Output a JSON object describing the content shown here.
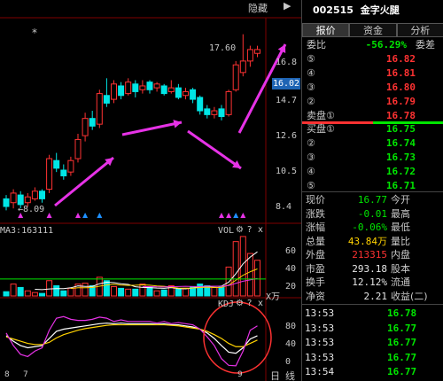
{
  "toolbar": {
    "hide_label": "隐藏",
    "arrow_icon": "chevron-right"
  },
  "chart": {
    "star_marker": "*",
    "high_label": "17.60",
    "low_label": "8.09",
    "current_price": "16.02",
    "price_axis": [
      "16.8",
      "14.7",
      "12.6",
      "10.5",
      "8.4"
    ],
    "vol_axis": [
      "60",
      "40",
      "20"
    ],
    "vol_unit": "X万",
    "kdj_axis": [
      "80",
      "40",
      "0"
    ],
    "ma_label": "MA3:163111",
    "vol_label": "VOL",
    "kdj_label": "KDJ",
    "gear_icon": "gear",
    "help_icon": "?",
    "close_icon": "x",
    "bottom_labels": [
      "8",
      "7",
      "9",
      "日",
      "线"
    ],
    "colors": {
      "up": "#ff3232",
      "down": "#00e6e6",
      "arrow": "#e632e6",
      "k": "#ffffff",
      "d": "#ffd200",
      "j": "#e632e6",
      "circle": "#ff3232"
    }
  },
  "chart_data": {
    "type": "candlestick",
    "candles": [
      {
        "o": 9.0,
        "c": 8.6,
        "h": 9.2,
        "l": 8.4
      },
      {
        "o": 8.8,
        "c": 9.3,
        "h": 9.5,
        "l": 8.5
      },
      {
        "o": 9.2,
        "c": 8.7,
        "h": 9.4,
        "l": 8.5
      },
      {
        "o": 8.8,
        "c": 9.1,
        "h": 9.3,
        "l": 8.6
      },
      {
        "o": 9.0,
        "c": 9.4,
        "h": 9.6,
        "l": 8.9
      },
      {
        "o": 9.4,
        "c": 9.0,
        "h": 9.5,
        "l": 8.8
      },
      {
        "o": 9.5,
        "c": 11.1,
        "h": 11.3,
        "l": 9.3
      },
      {
        "o": 11.0,
        "c": 10.6,
        "h": 11.4,
        "l": 10.4
      },
      {
        "o": 10.5,
        "c": 10.2,
        "h": 10.8,
        "l": 10.0
      },
      {
        "o": 10.4,
        "c": 11.0,
        "h": 11.2,
        "l": 10.2
      },
      {
        "o": 11.1,
        "c": 12.1,
        "h": 12.4,
        "l": 10.9
      },
      {
        "o": 12.3,
        "c": 13.2,
        "h": 13.5,
        "l": 12.0
      },
      {
        "o": 13.2,
        "c": 12.8,
        "h": 13.6,
        "l": 12.6
      },
      {
        "o": 12.9,
        "c": 14.5,
        "h": 14.7,
        "l": 12.7
      },
      {
        "o": 14.4,
        "c": 14.0,
        "h": 15.3,
        "l": 13.8
      },
      {
        "o": 14.2,
        "c": 15.0,
        "h": 15.2,
        "l": 14.0
      },
      {
        "o": 14.9,
        "c": 14.4,
        "h": 15.1,
        "l": 14.2
      },
      {
        "o": 14.5,
        "c": 15.1,
        "h": 15.3,
        "l": 14.4
      },
      {
        "o": 15.0,
        "c": 14.6,
        "h": 15.2,
        "l": 14.3
      },
      {
        "o": 14.7,
        "c": 14.9,
        "h": 15.2,
        "l": 14.5
      },
      {
        "o": 15.1,
        "c": 14.7,
        "h": 15.2,
        "l": 14.5
      },
      {
        "o": 14.8,
        "c": 15.0,
        "h": 15.1,
        "l": 14.6
      },
      {
        "o": 14.9,
        "c": 14.5,
        "h": 15.0,
        "l": 14.4
      },
      {
        "o": 14.6,
        "c": 14.8,
        "h": 15.2,
        "l": 14.5
      },
      {
        "o": 14.8,
        "c": 14.3,
        "h": 15.0,
        "l": 14.2
      },
      {
        "o": 14.4,
        "c": 14.6,
        "h": 14.8,
        "l": 14.2
      },
      {
        "o": 14.7,
        "c": 14.2,
        "h": 14.8,
        "l": 14.0
      },
      {
        "o": 14.3,
        "c": 13.6,
        "h": 14.4,
        "l": 13.4
      },
      {
        "o": 13.7,
        "c": 13.4,
        "h": 13.9,
        "l": 13.2
      },
      {
        "o": 13.4,
        "c": 13.6,
        "h": 13.8,
        "l": 13.2
      },
      {
        "o": 13.7,
        "c": 13.3,
        "h": 13.9,
        "l": 13.1
      },
      {
        "o": 13.4,
        "c": 14.6,
        "h": 14.7,
        "l": 13.3
      },
      {
        "o": 14.7,
        "c": 16.0,
        "h": 16.2,
        "l": 14.6
      },
      {
        "o": 15.6,
        "c": 16.2,
        "h": 17.6,
        "l": 15.4
      },
      {
        "o": 16.2,
        "c": 16.8,
        "h": 17.0,
        "l": 15.9
      },
      {
        "o": 16.6,
        "c": 16.8,
        "h": 17.0,
        "l": 16.4
      }
    ],
    "volumes": [
      5,
      14,
      10,
      6,
      4,
      3,
      18,
      12,
      6,
      9,
      14,
      15,
      12,
      22,
      18,
      11,
      9,
      8,
      8,
      14,
      10,
      6,
      7,
      12,
      8,
      9,
      11,
      14,
      12,
      10,
      11,
      34,
      64,
      70,
      50,
      42
    ],
    "kdj": {
      "k": [
        50,
        40,
        32,
        28,
        30,
        32,
        45,
        58,
        62,
        64,
        66,
        68,
        70,
        72,
        73,
        72,
        73,
        72,
        72,
        72,
        72,
        71,
        72,
        70,
        70,
        68,
        66,
        62,
        55,
        45,
        32,
        20,
        18,
        28,
        44,
        50
      ],
      "d": [
        48,
        44,
        40,
        36,
        34,
        34,
        38,
        46,
        52,
        56,
        60,
        63,
        65,
        67,
        69,
        70,
        70,
        70,
        70,
        70,
        70,
        70,
        70,
        69,
        68,
        66,
        64,
        62,
        58,
        52,
        45,
        36,
        30,
        30,
        36,
        42
      ],
      "j": [
        55,
        32,
        16,
        12,
        22,
        28,
        60,
        82,
        85,
        80,
        78,
        78,
        80,
        84,
        82,
        76,
        79,
        76,
        76,
        76,
        76,
        73,
        76,
        72,
        74,
        72,
        70,
        62,
        48,
        32,
        8,
        -4,
        -5,
        22,
        60,
        68
      ]
    }
  },
  "stock": {
    "code": "002515",
    "name": "金字火腿"
  },
  "tabs": [
    "报价",
    "资金",
    "分析"
  ],
  "weibi": {
    "label": "委比",
    "value": "-56.29%",
    "label2": "委差",
    "value2": ""
  },
  "sell_orders": [
    {
      "label": "⑤",
      "price": "16.82",
      "vol": ""
    },
    {
      "label": "④",
      "price": "16.81",
      "vol": ""
    },
    {
      "label": "③",
      "price": "16.80",
      "vol": ""
    },
    {
      "label": "②",
      "price": "16.79",
      "vol": ""
    },
    {
      "label": "卖盘①",
      "price": "16.78",
      "vol": ""
    }
  ],
  "buy_orders": [
    {
      "label": "买盘①",
      "price": "16.75",
      "vol": ""
    },
    {
      "label": "②",
      "price": "16.74",
      "vol": ""
    },
    {
      "label": "③",
      "price": "16.73",
      "vol": ""
    },
    {
      "label": "④",
      "price": "16.72",
      "vol": ""
    },
    {
      "label": "⑤",
      "price": "16.71",
      "vol": ""
    }
  ],
  "info": [
    {
      "l1": "现价",
      "v1": "16.77",
      "c1": "green",
      "l2": "今开"
    },
    {
      "l1": "涨跌",
      "v1": "-0.01",
      "c1": "green",
      "l2": "最高"
    },
    {
      "l1": "涨幅",
      "v1": "-0.06%",
      "c1": "green",
      "l2": "最低"
    },
    {
      "l1": "总量",
      "v1": "43.84万",
      "c1": "yellow",
      "l2": "量比"
    },
    {
      "l1": "外盘",
      "v1": "213315",
      "c1": "red",
      "l2": "内盘"
    },
    {
      "l1": "市盈",
      "v1": "293.18",
      "c1": "white",
      "l2": "股本"
    },
    {
      "l1": "换手",
      "v1": "12.12%",
      "c1": "white",
      "l2": "流通"
    },
    {
      "l1": "净资",
      "v1": "2.21",
      "c1": "white",
      "l2": "收益(二)"
    }
  ],
  "ticks": [
    {
      "time": "13:53",
      "price": "16.78"
    },
    {
      "time": "13:53",
      "price": "16.77"
    },
    {
      "time": "13:53",
      "price": "16.77"
    },
    {
      "time": "13:53",
      "price": "16.77"
    },
    {
      "time": "13:54",
      "price": "16.77"
    }
  ]
}
